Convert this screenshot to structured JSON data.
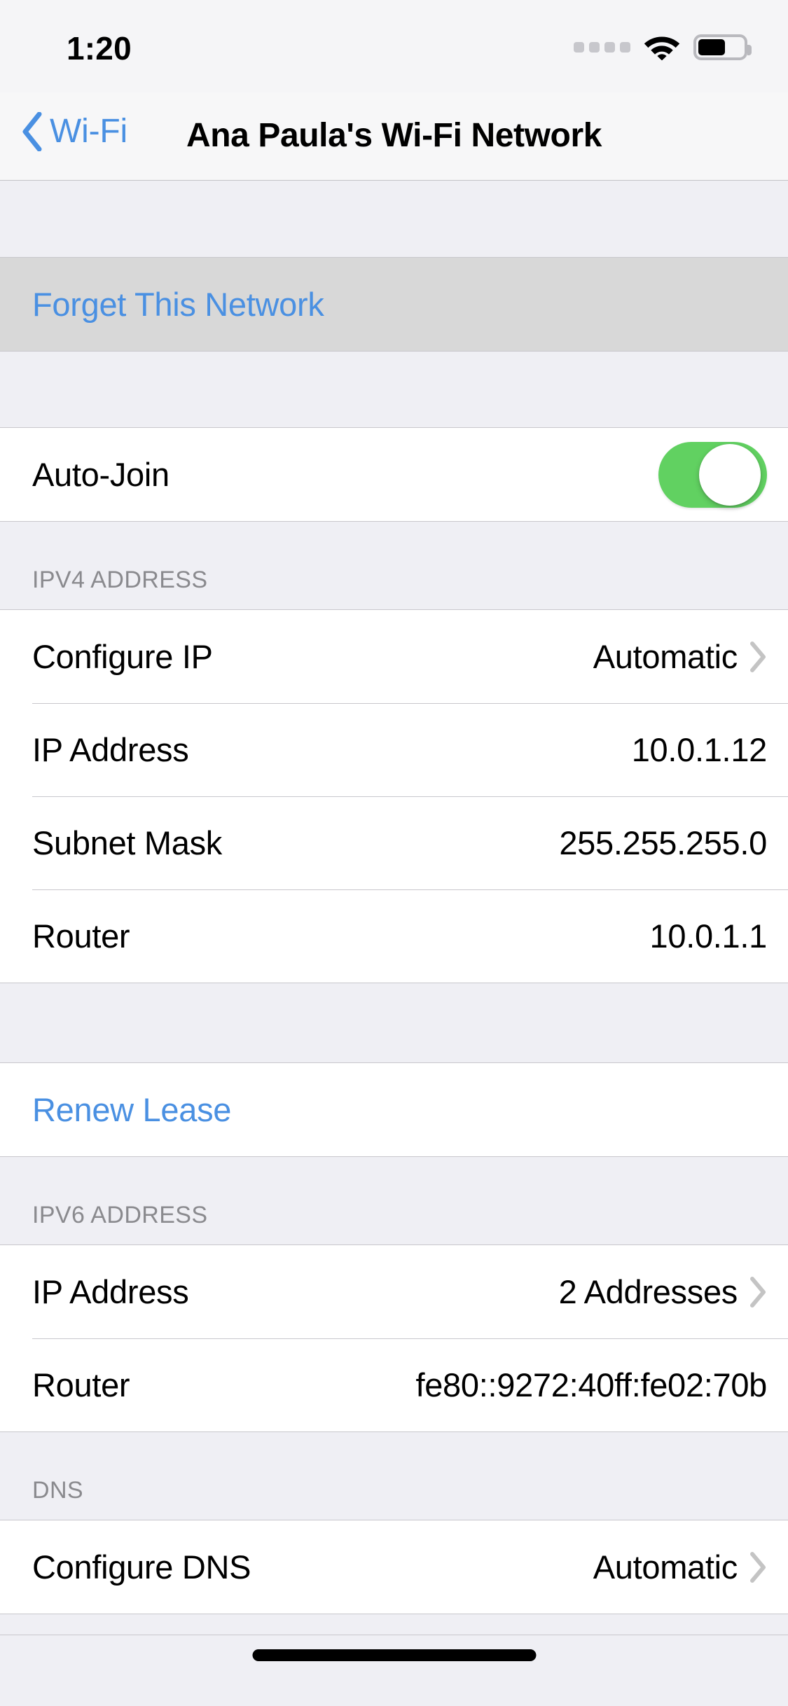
{
  "status_bar": {
    "time": "1:20",
    "signal_icon": "signal-dots-icon",
    "signal_bars_total": 4,
    "signal_bars_active": 0,
    "wifi_icon": "wifi-icon",
    "wifi_strength": "full",
    "battery_icon": "battery-icon",
    "battery_level_percent": 55
  },
  "nav_bar": {
    "back_icon": "chevron-left-icon",
    "back_label": "Wi-Fi",
    "title": "Ana Paula's Wi-Fi Network",
    "back_color": "#4A90E2",
    "title_color": "#000000"
  },
  "sections": [
    {
      "id": "forget",
      "header": "",
      "pressed": true,
      "rows": [
        {
          "label": "Forget This Network",
          "type": "link",
          "value": "",
          "chevron": false
        }
      ]
    },
    {
      "id": "auto-join",
      "header": "",
      "rows": [
        {
          "label": "Auto-Join",
          "type": "switch",
          "value": "",
          "switch_on": true,
          "chevron": false
        }
      ]
    },
    {
      "id": "ipv4",
      "header": "IPV4 ADDRESS",
      "rows": [
        {
          "label": "Configure IP",
          "type": "value",
          "value": "Automatic",
          "chevron": true
        },
        {
          "label": "IP Address",
          "type": "value",
          "value": "10.0.1.12",
          "chevron": false
        },
        {
          "label": "Subnet Mask",
          "type": "value",
          "value": "255.255.255.0",
          "chevron": false
        },
        {
          "label": "Router",
          "type": "value",
          "value": "10.0.1.1",
          "chevron": false
        }
      ]
    },
    {
      "id": "renew",
      "header": "",
      "rows": [
        {
          "label": "Renew Lease",
          "type": "link",
          "value": "",
          "chevron": false
        }
      ]
    },
    {
      "id": "ipv6",
      "header": "IPV6 ADDRESS",
      "rows": [
        {
          "label": "IP Address",
          "type": "value",
          "value": "2 Addresses",
          "chevron": true
        },
        {
          "label": "Router",
          "type": "value",
          "value": "fe80::9272:40ff:fe02:70b",
          "chevron": false
        }
      ]
    },
    {
      "id": "dns",
      "header": "DNS",
      "rows": [
        {
          "label": "Configure DNS",
          "type": "value",
          "value": "Automatic",
          "chevron": true
        }
      ]
    }
  ],
  "home_indicator": {
    "icon": "home-indicator-bar",
    "color": "#000000"
  },
  "colors": {
    "accent_blue": "#4A90E2",
    "switch_green": "#61D161",
    "group_background": "#EFEFF4",
    "row_background": "#FFFFFF",
    "pressed_row_background": "#D8D8D8",
    "separator": "#C8C7CC",
    "header_text": "#8A8A8E",
    "chevron": "#C4C4C4"
  }
}
